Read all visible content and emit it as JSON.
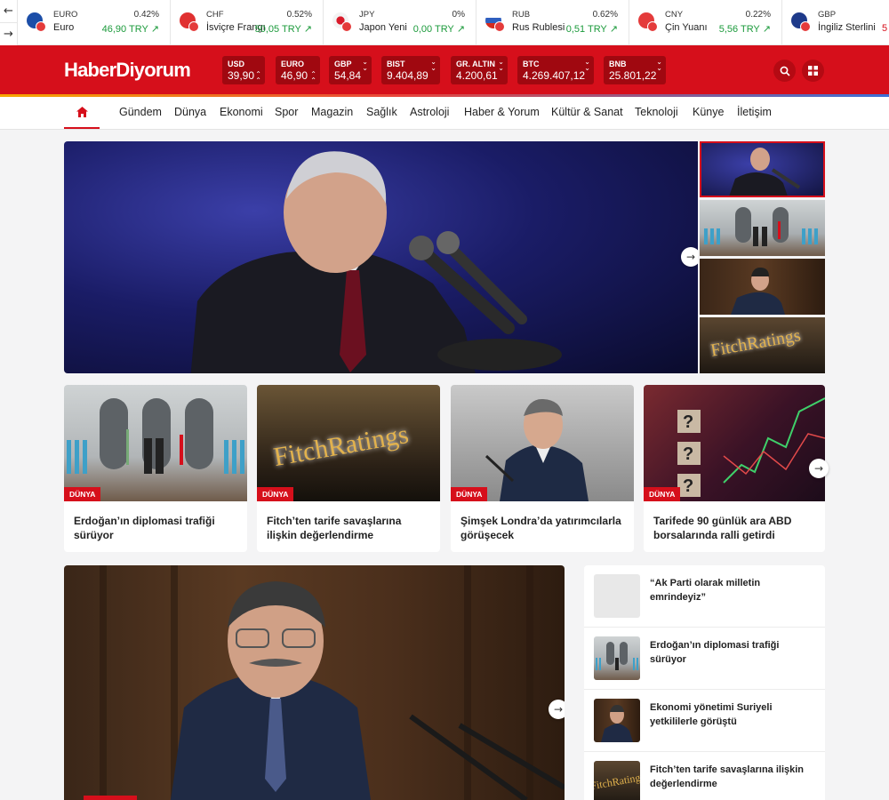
{
  "ticker": {
    "prev_label": "←",
    "next_label": "→",
    "items": [
      {
        "code": "EURO",
        "pct": "0.42%",
        "name": "Euro",
        "value": "46,90 TRY",
        "flag_color": "#1c4ea8"
      },
      {
        "code": "CHF",
        "pct": "0.52%",
        "name": "İsviçre Frangı",
        "value": "50,05 TRY",
        "flag_color": "#e03030"
      },
      {
        "code": "JPY",
        "pct": "0%",
        "name": "Japon Yeni",
        "value": "0,00 TRY",
        "flag_color": "#f3f3f3"
      },
      {
        "code": "RUB",
        "pct": "0.62%",
        "name": "Rus Rublesi",
        "value": "0,51 TRY",
        "flag_color": "#2f5fbf"
      },
      {
        "code": "CNY",
        "pct": "0.22%",
        "name": "Çin Yuanı",
        "value": "5,56 TRY",
        "flag_color": "#e43b3b"
      },
      {
        "code": "GBP",
        "pct": "",
        "name": "İngiliz Sterlini",
        "value": "5",
        "flag_color": "#1e3a8a"
      }
    ],
    "up_arrow": "↗"
  },
  "header": {
    "logo": "HaberDiyorum",
    "markets": [
      {
        "code": "USD",
        "value": "39,90"
      },
      {
        "code": "EURO",
        "value": "46,90"
      },
      {
        "code": "GBP",
        "value": "54,84"
      },
      {
        "code": "BIST",
        "value": "9.404,89"
      },
      {
        "code": "GR. ALTIN",
        "value": "4.200,61"
      },
      {
        "code": "BTC",
        "value": "4.269.407,12"
      },
      {
        "code": "BNB",
        "value": "25.801,22"
      }
    ],
    "search_icon": "⌕",
    "grid_icon": "▦",
    "accent": "#d60f1b"
  },
  "nav": {
    "home_icon": "⌂",
    "items": [
      "Gündem",
      "Dünya",
      "Ekonomi",
      "Spor",
      "Magazin",
      "Sağlık",
      "Astroloji",
      "Haber & Yorum",
      "Kültür & Sanat",
      "Teknoloji",
      "Künye",
      "İletişim"
    ]
  },
  "hero": {
    "next_arrow": "→"
  },
  "cards": [
    {
      "category": "DÜNYA",
      "title": "Erdoğan’ın diplomasi trafiği sürüyor"
    },
    {
      "category": "DÜNYA",
      "title": "Fitch’ten tarife savaşlarına ilişkin değerlendirme",
      "img_text": "FitchRatings"
    },
    {
      "category": "DÜNYA",
      "title": "Şimşek Londra’da yatırımcılarla görüşecek"
    },
    {
      "category": "DÜNYA",
      "title": "Tarifede 90 günlük ara ABD borsalarında ralli getirdi"
    }
  ],
  "thumb_fitch_text": "FitchRatings",
  "feature": {
    "next_arrow": "→"
  },
  "sidebar_list": [
    {
      "title": "“Ak Parti olarak milletin emrindeyiz”"
    },
    {
      "title": "Erdoğan’ın diplomasi trafiği sürüyor"
    },
    {
      "title": "Ekonomi yönetimi Suriyeli yetkililerle görüştü"
    },
    {
      "title": "Fitch’ten tarife savaşlarına ilişkin değerlendirme",
      "img_text": "FitchRatings"
    }
  ]
}
